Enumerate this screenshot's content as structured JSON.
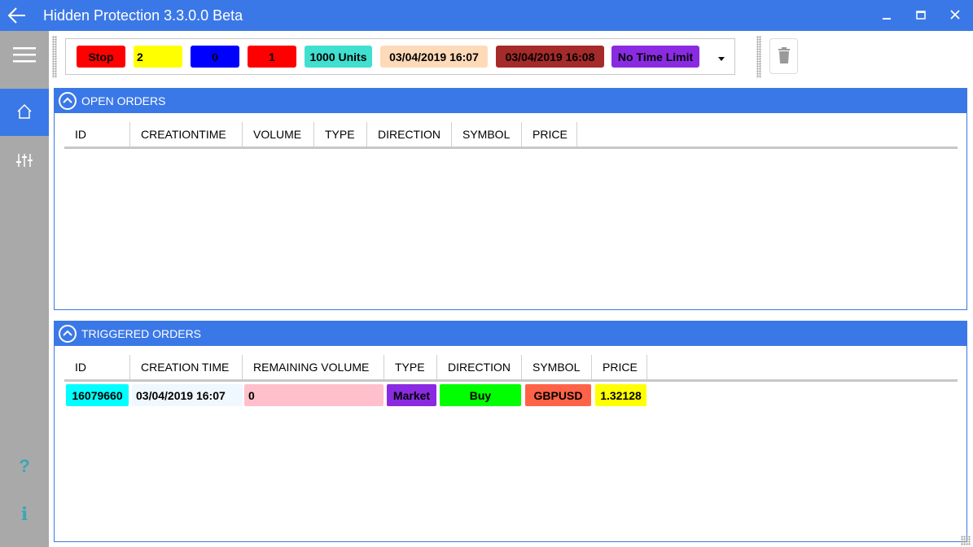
{
  "window": {
    "title": "Hidden Protection 3.3.0.0 Beta",
    "back_icon": "back-arrow-icon",
    "minimize_icon": "minimize-icon",
    "maximize_icon": "maximize-icon",
    "close_icon": "close-icon"
  },
  "sidebar": {
    "menu_icon": "hamburger-icon",
    "items": [
      {
        "icon": "home-icon",
        "active": true
      },
      {
        "icon": "sliders-icon",
        "active": false
      }
    ],
    "help": "?",
    "info": "i"
  },
  "toolbar": {
    "chips": [
      {
        "label": "Stop",
        "bg": "#ff0000",
        "fg": "#000000"
      },
      {
        "label": "2",
        "bg": "#ffff00",
        "fg": "#000000"
      },
      {
        "label": "0",
        "bg": "#0000ff",
        "fg": "#000000"
      },
      {
        "label": "1",
        "bg": "#ff0000",
        "fg": "#000000"
      },
      {
        "label": "1000 Units",
        "bg": "#40e0d0",
        "fg": "#000000"
      },
      {
        "label": "03/04/2019 16:07",
        "bg": "#ffdab9",
        "fg": "#000000"
      },
      {
        "label": "03/04/2019 16:08",
        "bg": "#a52a2a",
        "fg": "#000000"
      },
      {
        "label": "No Time Limit",
        "bg": "#8a2be2",
        "fg": "#000000"
      }
    ],
    "dropdown_icon": "chevron-down-icon",
    "delete_icon": "trash-icon"
  },
  "open_orders": {
    "title": "OPEN ORDERS",
    "columns": [
      "ID",
      "CREATIONTIME",
      "VOLUME",
      "TYPE",
      "DIRECTION",
      "SYMBOL",
      "PRICE"
    ],
    "rows": []
  },
  "triggered_orders": {
    "title": "TRIGGERED ORDERS",
    "columns": [
      "ID",
      "CREATION TIME",
      "REMAINING VOLUME",
      "TYPE",
      "DIRECTION",
      "SYMBOL",
      "PRICE"
    ],
    "rows": [
      {
        "id": "16079660",
        "creation_time": "03/04/2019 16:07",
        "remaining_volume": "0",
        "type": "Market",
        "direction": "Buy",
        "symbol": "GBPUSD",
        "price": "1.32128"
      }
    ]
  },
  "colors": {
    "accent": "#3b78e7",
    "sidebar": "#a9a9a9",
    "id_cell": "#00ffff",
    "time_cell": "#f0f8ff",
    "volume_cell": "#ffc0cb",
    "type_cell": "#8a2be2",
    "direction_cell": "#00ff00",
    "symbol_cell": "#ff6347",
    "price_cell": "#ffff00"
  }
}
